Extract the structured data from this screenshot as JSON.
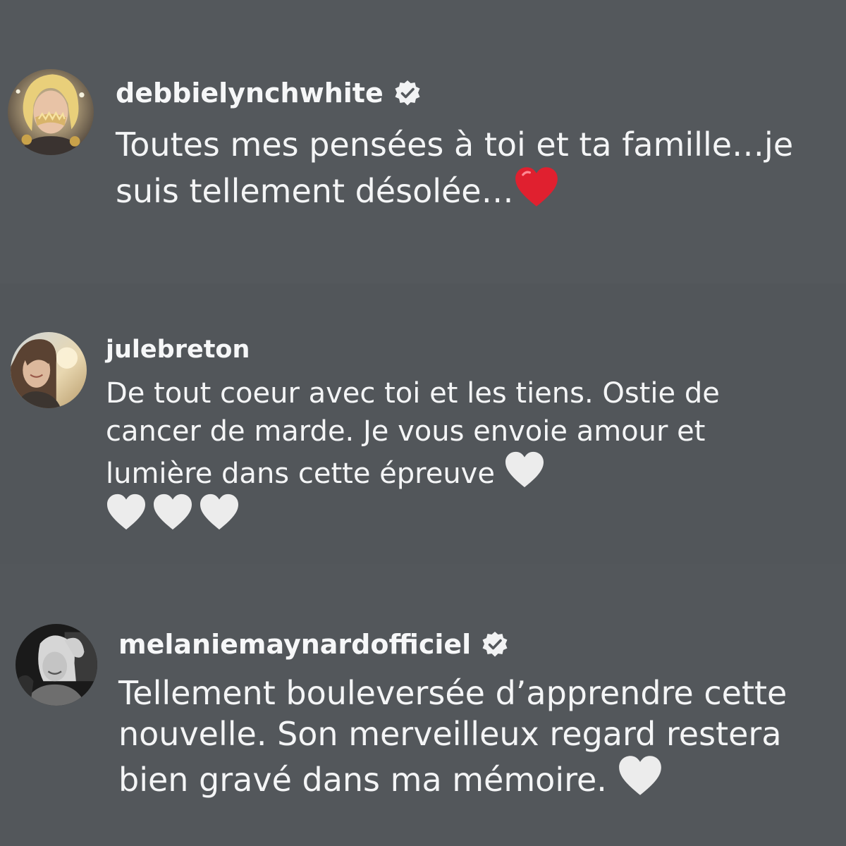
{
  "colors": {
    "background": "#53575b",
    "text": "#f4f5f6",
    "verified_badge": "#f2f3f4",
    "red_heart": "#e0202f",
    "white_heart": "#ececec"
  },
  "comments": [
    {
      "username": "debbielynchwhite",
      "verified": true,
      "avatar": "avatar-debbielynchwhite",
      "text": "Toutes mes pensées à toi et ta famille…je suis tellement désolée…",
      "emoji": "red-heart-icon"
    },
    {
      "username": "julebreton",
      "verified": false,
      "avatar": "avatar-julebreton",
      "text": "De tout coeur avec toi et les tiens. Ostie de cancer de marde. Je vous envoie amour et lumière dans cette épreuve",
      "emoji": "white-heart-icon"
    },
    {
      "username": "melaniemaynardofficiel",
      "verified": true,
      "avatar": "avatar-melaniemaynardofficiel",
      "text": "Tellement bouleversée d’apprendre cette nouvelle. Son merveilleux regard restera bien gravé dans ma mémoire.",
      "emoji": "white-heart-icon"
    }
  ]
}
